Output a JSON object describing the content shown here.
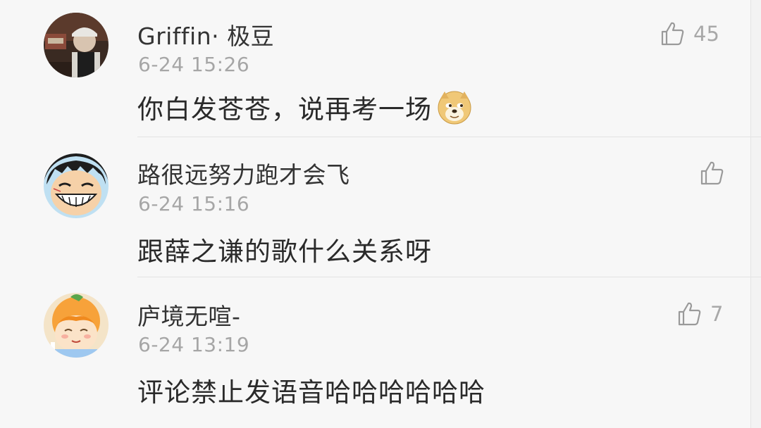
{
  "comments": [
    {
      "username": "Griffin· 极豆",
      "timestamp": "6-24 15:26",
      "content": "你白发苍苍，说再考一场",
      "emoji": "doge-emoji",
      "likes": "45"
    },
    {
      "username": "路很远努力跑才会飞",
      "timestamp": "6-24 15:16",
      "content": "跟薛之谦的歌什么关系呀",
      "likes": ""
    },
    {
      "username": "庐境无喧-",
      "timestamp": "6-24 13:19",
      "content": "评论禁止发语音哈哈哈哈哈哈",
      "likes": "7"
    }
  ],
  "icons": {
    "like": "thumbs-up-outline-icon"
  },
  "colors": {
    "background": "#f7f7f7",
    "username": "#333333",
    "timestamp": "#a6a6a6",
    "like_icon": "#9a9a9a",
    "divider": "#e3e3e3"
  }
}
